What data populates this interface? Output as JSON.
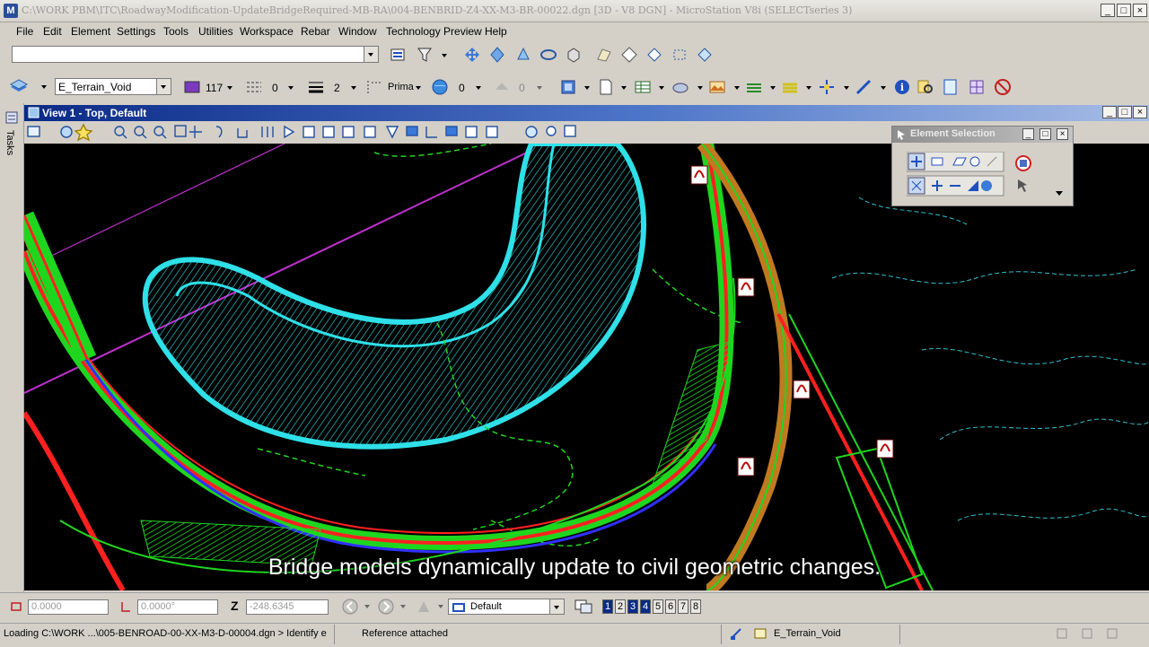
{
  "window": {
    "title": "C:\\WORK PBM\\ITC\\RoadwayModification-UpdateBridgeRequired-MB-RA\\004-BENBRID-Z4-XX-M3-BR-00022.dgn [3D - V8 DGN] - MicroStation V8i (SELECTseries 3)",
    "app_icon": "M",
    "controls": [
      "_",
      "□",
      "×"
    ]
  },
  "menu": [
    "File",
    "Edit",
    "Element",
    "Settings",
    "Tools",
    "Utilities",
    "Workspace",
    "Rebar",
    "Window",
    "Technology Preview",
    "Help"
  ],
  "attributes": {
    "level": "E_Terrain_Void",
    "color": "117",
    "line_style": "0",
    "weight": "2",
    "class": "Prima",
    "transparency": "0",
    "priority": "0"
  },
  "view": {
    "title": "View 1 - Top, Default",
    "side_tab": "Tasks"
  },
  "element_selection": {
    "title": "Element Selection"
  },
  "caption": "Bridge models dynamically update to civil geometric changes.",
  "coords": {
    "x": "0.0000",
    "angle": "0.0000°",
    "z_label": "Z",
    "z": "-248.6345",
    "view_group": "Default",
    "view_numbers": [
      "1",
      "2",
      "3",
      "4",
      "5",
      "6",
      "7",
      "8"
    ]
  },
  "status": {
    "prompt": "Loading C:\\WORK ...\\005-BENROAD-00-XX-M3-D-00004.dgn > Identify e",
    "message": "Reference attached",
    "active_level": "E_Terrain_Void"
  },
  "colors": {
    "view_title": "#0b2a86",
    "terrain": "#2fe0e8",
    "alignment_green": "#1fd61f",
    "alignment_red": "#ff2020",
    "alignment_blue": "#3030ff",
    "reference_magenta": "#c030d0",
    "canvas": "#000000"
  },
  "icons": {
    "tasks": "tasks-icon",
    "pdf_markers": "pdf-icon"
  }
}
